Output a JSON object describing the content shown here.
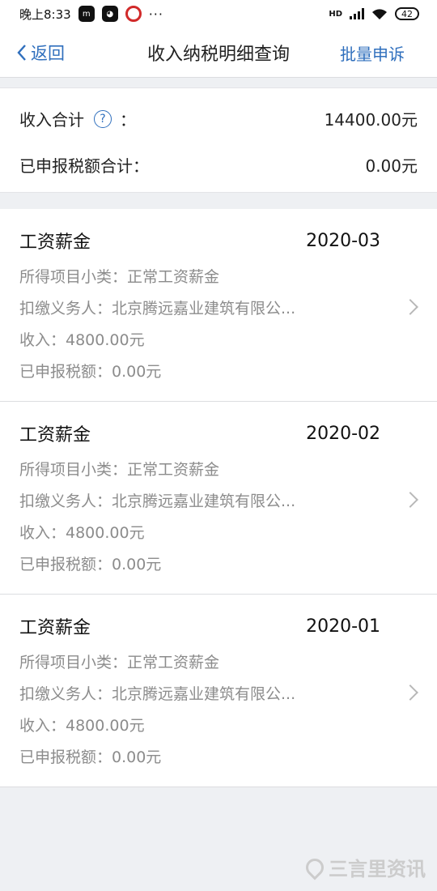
{
  "status_bar": {
    "time": "晚上8:33",
    "dots": "···",
    "network": "HD",
    "battery": "42"
  },
  "nav": {
    "back_label": "返回",
    "title": "收入纳税明细查询",
    "action_label": "批量申诉"
  },
  "summary": {
    "income_label": "收入合计",
    "colon": "：",
    "income_value": "14400.00元",
    "reported_label": "已申报税额合计：",
    "reported_value": "0.00元"
  },
  "records": [
    {
      "category": "工资薪金",
      "period": "2020-03",
      "subcategory": "所得项目小类：正常工资薪金",
      "withholder": "扣缴义务人：北京腾远嘉业建筑有限公...",
      "income": "收入：4800.00元",
      "tax": "已申报税额：0.00元"
    },
    {
      "category": "工资薪金",
      "period": "2020-02",
      "subcategory": "所得项目小类：正常工资薪金",
      "withholder": "扣缴义务人：北京腾远嘉业建筑有限公...",
      "income": "收入：4800.00元",
      "tax": "已申报税额：0.00元"
    },
    {
      "category": "工资薪金",
      "period": "2020-01",
      "subcategory": "所得项目小类：正常工资薪金",
      "withholder": "扣缴义务人：北京腾远嘉业建筑有限公...",
      "income": "收入：4800.00元",
      "tax": "已申报税额：0.00元"
    }
  ],
  "watermark": {
    "text": "三言里资讯"
  },
  "colors": {
    "accent": "#2f6fbd",
    "muted_text": "#8c8c8c",
    "background": "#eef0f3"
  }
}
